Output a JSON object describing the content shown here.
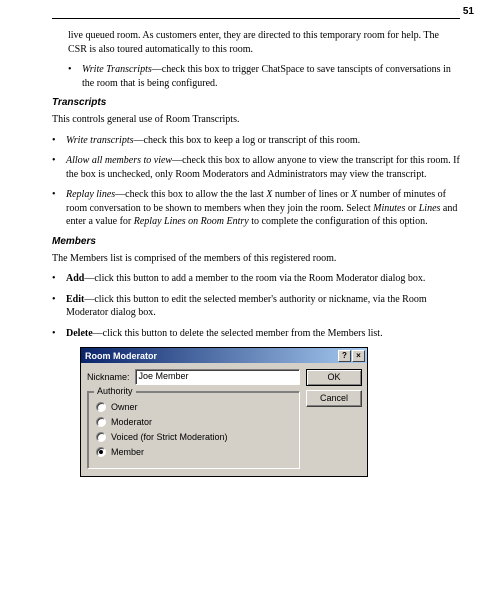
{
  "pageNumber": "51",
  "topParagraph": "live queued room.  As customers enter, they are directed to this temporary room for help.  The CSR is also toured automatically to this room.",
  "writeTranscripts1_term": "Write Transcripts",
  "writeTranscripts1_rest": "—check this box to trigger ChatSpace to save tanscipts of conversations in the room that is being configured.",
  "section1_head": "Transcripts",
  "section1_intro": "This controls general use of Room Transcripts.",
  "s1_b1_term": "Write transcripts",
  "s1_b1_rest": "—check this box to keep a log or transcript of this room.",
  "s1_b2_term": "Allow all members to view",
  "s1_b2_rest": "—check this box to allow anyone to view the transcript for this room. If the box is unchecked, only Room Moderators and Administrators may view the transcript.",
  "s1_b3_term": "Replay lines",
  "s1_b3_rest_a": "—check this box to allow the the last ",
  "s1_b3_x1": "X",
  "s1_b3_rest_b": " number of lines or ",
  "s1_b3_x2": "X",
  "s1_b3_rest_c": " number of minutes of room conversation to be shown to members when they join the room.  Select ",
  "s1_b3_min": "Minutes",
  "s1_b3_or": " or ",
  "s1_b3_lines": "Lines",
  "s1_b3_rest_d": " and enter a value for ",
  "s1_b3_entry": "Replay Lines on Room Entry",
  "s1_b3_rest_e": " to complete the configuration of this option.",
  "section2_head": "Members",
  "section2_intro": "The Members list is comprised of the members of this registered room.",
  "s2_b1_term": "Add",
  "s2_b1_rest": "—click this button to add a member to the room via the Room Moderator dialog box.",
  "s2_b2_term": "Edit",
  "s2_b2_rest": "—click this button to edit the selected member's authority or nickname, via the Room Moderator dialog box.",
  "s2_b3_term": "Delete",
  "s2_b3_rest": "—click this button to delete the selected member from the Members list.",
  "dialog": {
    "title": "Room Moderator",
    "ok": "OK",
    "cancel": "Cancel",
    "nickLabel": "Nickname:",
    "nickValue": "Joe Member",
    "groupLegend": "Authority",
    "opt1": "Owner",
    "opt2": "Moderator",
    "opt3": "Voiced (for Strict Moderation)",
    "opt4": "Member",
    "help": "?",
    "close": "×"
  }
}
